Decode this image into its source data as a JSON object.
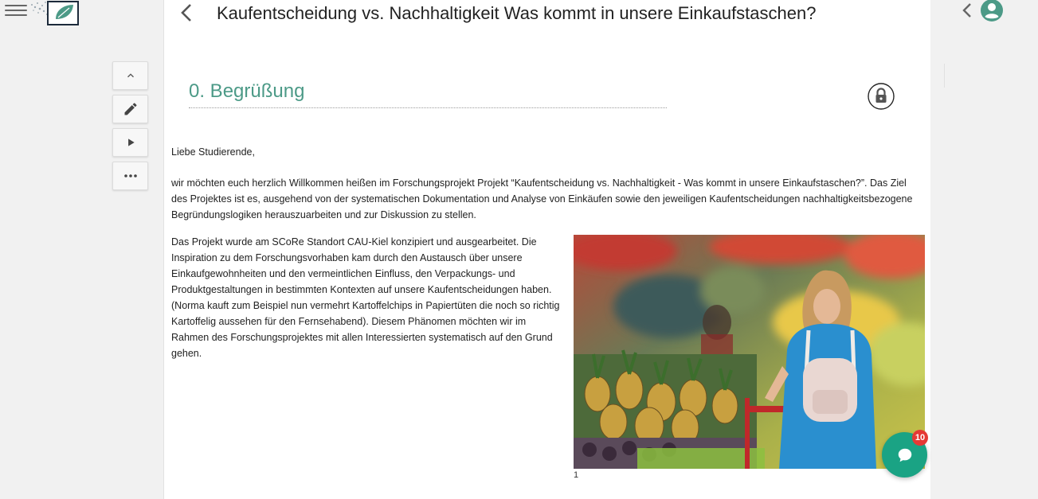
{
  "header": {
    "title": "Kaufentscheidung vs. Nachhaltigkeit Was kommt in unsere Einkaufstaschen?"
  },
  "section": {
    "heading": "0. Begrüßung"
  },
  "content": {
    "greeting": "Liebe Studierende,",
    "intro": "wir möchten euch herzlich Willkommen heißen im Forschungsprojekt Projekt “Kaufentscheidung vs. Nachhaltigkeit - Was kommt in unsere Einkaufstaschen?”. Das Ziel des Projektes ist es, ausgehend von der systematischen Dokumentation und Analyse von Einkäufen sowie den jeweiligen Kaufentscheidungen nachhaltigkeitsbezogene Begründungslogiken herauszuarbeiten und zur Diskussion zu stellen.",
    "project": "Das Projekt wurde am SCoRe Standort CAU-Kiel konzipiert und ausgearbeitet. Die Inspiration zu dem Forschungsvorhaben kam durch den Austausch über unsere Einkaufgewohnheiten und den vermeintlichen Einfluss, den Verpackungs- und Produktgestaltungen in bestimmten Kontexten auf unsere Kaufentscheidungen haben. (Norma kauft zum Beispiel nun vermehrt Kartoffelchips in Papiertüten die noch so richtig Kartoffelig aussehen für den Fernsehabend). Diesem Phänomen möchten wir im Rahmen des Forschungsprojektes mit allen Interessierten systematisch auf den Grund gehen.",
    "image_caption": "1"
  },
  "chat": {
    "badge_count": "10"
  },
  "icons": {
    "menu": "hamburger-icon",
    "logo": "logo-icon",
    "back": "chevron-left-icon",
    "lock": "lock-icon",
    "collapse": "chevron-up-icon",
    "edit": "pencil-icon",
    "play": "play-icon",
    "more": "more-horizontal-icon",
    "panel_toggle": "chevron-left-icon",
    "user": "account-circle-icon",
    "chat": "chat-bubble-icon"
  },
  "colors": {
    "accent": "#4c9a87",
    "chat_fab": "#1aa384",
    "badge": "#e53935"
  }
}
